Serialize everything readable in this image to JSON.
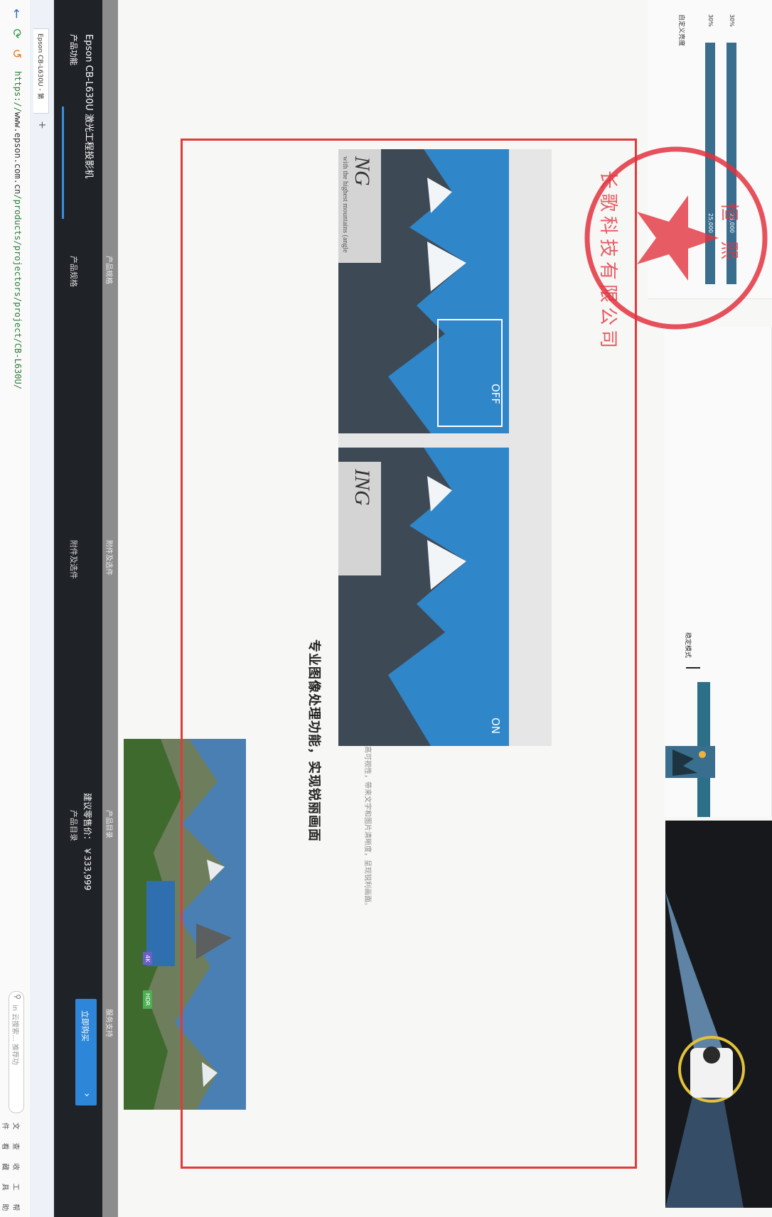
{
  "browser": {
    "url_prefix": "https://",
    "url_host": "www.epson.com.cn",
    "url_path": "/products/projectors/project/CB-L630U/",
    "tab_label": "Epson CB-L630U - 第",
    "search_placeholder": "in 云搜索... 推荐功",
    "menu": [
      "文件",
      "查看",
      "收藏",
      "工具",
      "帮助"
    ]
  },
  "site_nav": {
    "title": "Epson CB-L630U 激光工程投影机",
    "subtitle": "产品功能",
    "items": [
      "产品规格",
      "附件及选件",
      "产品目录"
    ],
    "price": "建议零售价： ￥333,999",
    "contact_label": "立即购买",
    "contact_icon": "chevron-right-icon"
  },
  "sub_nav": {
    "items": [
      "产品规格",
      "附件及选件",
      "产品目录",
      "服务支持"
    ]
  },
  "hero": {
    "tag1": "4K",
    "tag2": "HDR"
  },
  "feature": {
    "heading": "专业图像处理功能，实现锐丽画面",
    "description": "超级解像和细节增强功能可以增强高可视性，带来文字和图片清晰度，呈现锐利画面。"
  },
  "comparison": {
    "off_label": "OFF",
    "on_label": "ON",
    "ng_text": "NG",
    "ing_text": "ING",
    "caption": "with the highest mountains (angle"
  },
  "chart": {
    "axis_label": "自定义亮度",
    "bars": [
      {
        "label": "30%",
        "value": "25,000"
      },
      {
        "label": "30%",
        "value": "25,000"
      }
    ]
  },
  "diagram": {
    "label": "稳定模式"
  },
  "stamp": {
    "text": "长歌科技有限公司",
    "subtext": "恒 熙"
  }
}
